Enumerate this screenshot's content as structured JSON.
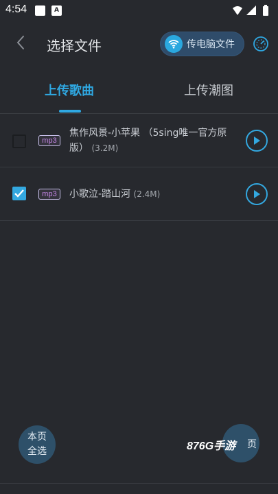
{
  "status_bar": {
    "time": "4:54",
    "notif_icon_letter": "A"
  },
  "header": {
    "title": "选择文件",
    "pc_upload_label": "传电脑文件"
  },
  "tabs": [
    {
      "label": "上传歌曲",
      "active": true
    },
    {
      "label": "上传潮图",
      "active": false
    }
  ],
  "files": [
    {
      "badge": "mp3",
      "title": "焦作风景-小苹果 （5sing唯一官方原版）",
      "title_line1": "焦作风景-小苹果 （5sing唯一官方原",
      "title_line2": "版）",
      "size": "(3.2M)",
      "checked": false
    },
    {
      "badge": "mp3",
      "title": "小歌泣-踏山河",
      "size": "(2.4M)",
      "checked": true
    }
  ],
  "bottom": {
    "select_all_line1": "本页",
    "select_all_line2": "全选",
    "right_button_visible_text": "页",
    "watermark": "876G手游"
  },
  "colors": {
    "accent": "#2fa8e2",
    "background": "#27292e",
    "badge": "#c586e6"
  }
}
